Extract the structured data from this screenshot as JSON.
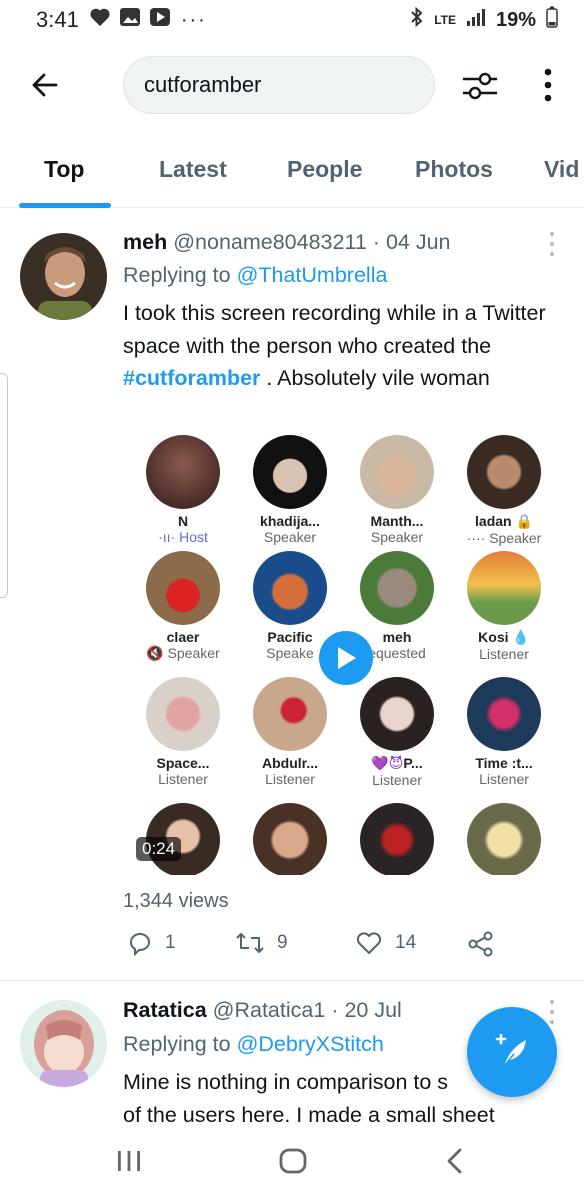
{
  "status_bar": {
    "time": "3:41",
    "overflow": "···",
    "network": "LTE",
    "battery": "19%",
    "icons": [
      "heart-icon",
      "gallery-icon",
      "youtube-icon",
      "bluetooth-icon",
      "signal-icon",
      "battery-icon"
    ]
  },
  "search": {
    "query": "cutforamber"
  },
  "tabs": [
    {
      "label": "Top",
      "active": true
    },
    {
      "label": "Latest",
      "active": false
    },
    {
      "label": "People",
      "active": false
    },
    {
      "label": "Photos",
      "active": false
    },
    {
      "label": "Vid",
      "active": false
    }
  ],
  "tweets": [
    {
      "name": "meh",
      "handle": "@noname80483211",
      "separator": "·",
      "date": "04 Jun",
      "replying_prefix": "Replying to",
      "replying_to": "@ThatUmbrella",
      "text_1": "I took this screen recording while in a Twitter space with the person who created the ",
      "hashtag": "#cutforamber",
      "text_2": " . Absolutely vile woman",
      "media": {
        "duration": "0:24",
        "participants": [
          {
            "name": "N",
            "role": "Host"
          },
          {
            "name": "khadija...",
            "role": "Speaker"
          },
          {
            "name": "Manth...",
            "role": "Speaker"
          },
          {
            "name": "ladan",
            "role": "Speaker"
          },
          {
            "name": "claer",
            "role": "Speaker"
          },
          {
            "name": "Pacific",
            "role": "Speake"
          },
          {
            "name": "meh",
            "role": "equested"
          },
          {
            "name": "Kosi",
            "role": "Listener"
          },
          {
            "name": "Space...",
            "role": "Listener"
          },
          {
            "name": "Abdulr...",
            "role": "Listener"
          },
          {
            "name": "P...",
            "role": "Listener"
          },
          {
            "name": "Time :t...",
            "role": "Listener"
          },
          {
            "name": "",
            "role": ""
          },
          {
            "name": "",
            "role": ""
          },
          {
            "name": "",
            "role": ""
          },
          {
            "name": "",
            "role": ""
          }
        ]
      },
      "views": "1,344 views",
      "replies": "1",
      "retweets": "9",
      "likes": "14"
    },
    {
      "name": "Ratatica",
      "handle": "@Ratatica1",
      "separator": "·",
      "date": "20 Jul",
      "replying_prefix": "Replying to",
      "replying_to": "@DebryXStitch",
      "text_1": "Mine is nothing in comparison to s",
      "text_2": "of the users here. I made a small sheet"
    }
  ],
  "colors": {
    "accent": "#1d9bf0",
    "text": "#0f1419",
    "muted": "#536471"
  }
}
